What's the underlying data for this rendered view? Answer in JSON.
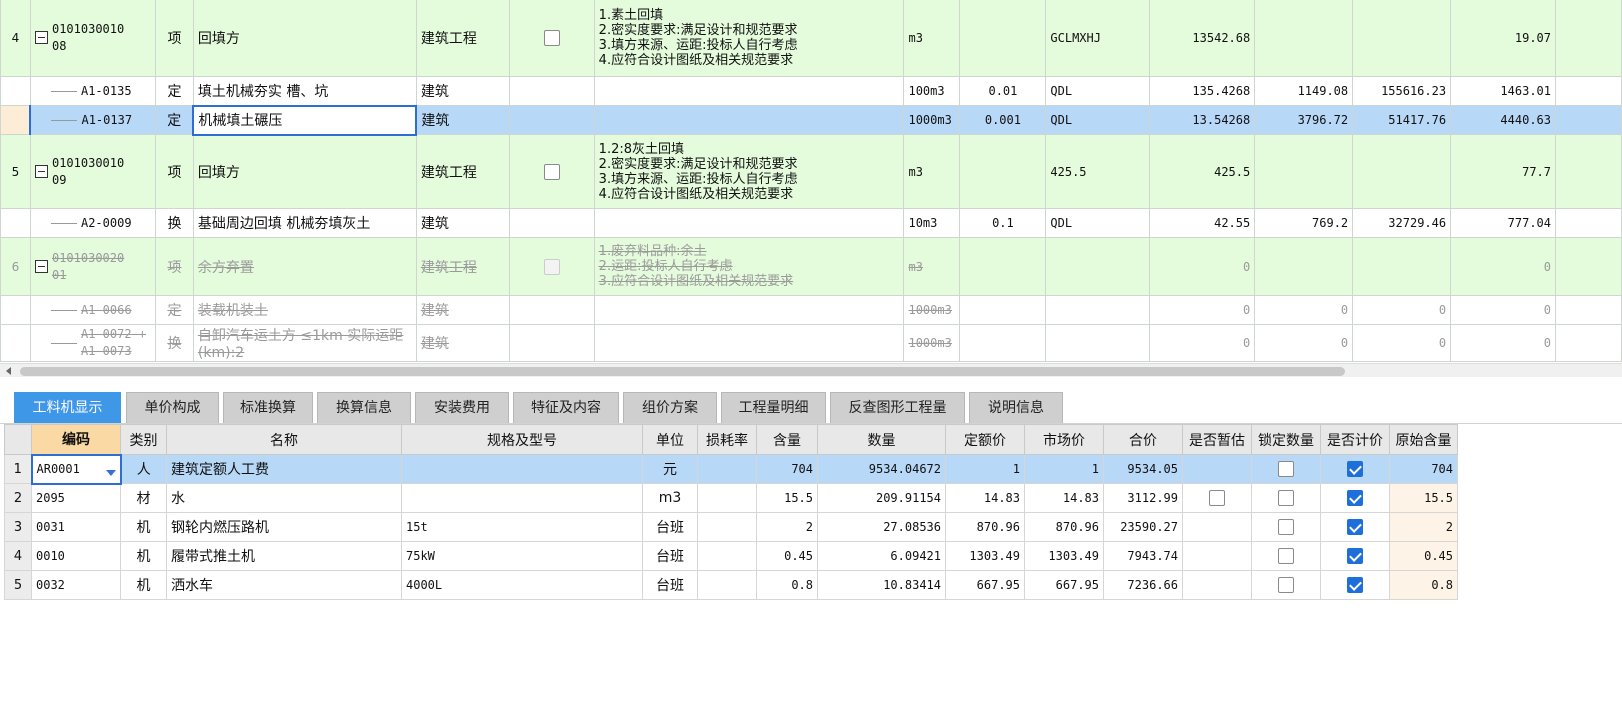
{
  "upper": {
    "rows": [
      {
        "type": "item",
        "no": "4",
        "code": [
          "0101030010",
          "08"
        ],
        "cat": "项",
        "name": "回填方",
        "prof": "建筑工程",
        "desc": [
          "1.素土回填",
          "2.密实度要求:满足设计和规范要求",
          "3.填方来源、运距:投标人自行考虑",
          "4.应符合设计图纸及相关规范要求"
        ],
        "unit": "m3",
        "coef": "",
        "expr": "GCLMXHJ",
        "qty": "13542.68",
        "p1": "",
        "p2": "",
        "p3": "19.07"
      },
      {
        "type": "sub",
        "no": "",
        "code": [
          "A1-0135"
        ],
        "cat": "定",
        "name": "填土机械夯实 槽、坑",
        "prof": "建筑",
        "desc": [],
        "unit": "100m3",
        "coef": "0.01",
        "expr": "QDL",
        "qty": "135.4268",
        "p1": "1149.08",
        "p2": "155616.23",
        "p3": "1463.01"
      },
      {
        "type": "sel",
        "no": "",
        "code": [
          "A1-0137"
        ],
        "cat": "定",
        "name": "机械填土碾压",
        "prof": "建筑",
        "desc": [],
        "unit": "1000m3",
        "coef": "0.001",
        "expr": "QDL",
        "qty": "13.54268",
        "p1": "3796.72",
        "p2": "51417.76",
        "p3": "4440.63"
      },
      {
        "type": "item",
        "no": "5",
        "code": [
          "0101030010",
          "09"
        ],
        "cat": "项",
        "name": "回填方",
        "prof": "建筑工程",
        "desc": [
          "1.2:8灰土回填",
          "2.密实度要求:满足设计和规范要求",
          "3.填方来源、运距:投标人自行考虑",
          "4.应符合设计图纸及相关规范要求"
        ],
        "unit": "m3",
        "coef": "",
        "expr": "425.5",
        "qty": "425.5",
        "p1": "",
        "p2": "",
        "p3": "77.7"
      },
      {
        "type": "sub",
        "no": "",
        "code": [
          "A2-0009"
        ],
        "cat": "换",
        "name": "基础周边回填 机械夯填灰土",
        "prof": "建筑",
        "desc": [],
        "unit": "10m3",
        "coef": "0.1",
        "expr": "QDL",
        "qty": "42.55",
        "p1": "769.2",
        "p2": "32729.46",
        "p3": "777.04"
      },
      {
        "type": "item-dis",
        "no": "6",
        "code": [
          "0101030020",
          "01"
        ],
        "cat": "项",
        "name": "余方弃置",
        "prof": "建筑工程",
        "desc": [
          "1.废弃料品种:余土",
          "2.运距:投标人自行考虑",
          "3.应符合设计图纸及相关规范要求"
        ],
        "unit": "m3",
        "coef": "",
        "expr": "",
        "qty": "0",
        "p1": "",
        "p2": "",
        "p3": "0"
      },
      {
        "type": "sub-dis",
        "no": "",
        "code": [
          "A1-0066"
        ],
        "cat": "定",
        "name": "装载机装土",
        "prof": "建筑",
        "desc": [],
        "unit": "1000m3",
        "coef": "",
        "expr": "",
        "qty": "0",
        "p1": "0",
        "p2": "0",
        "p3": "0"
      },
      {
        "type": "sub-dis",
        "no": "",
        "code": [
          "A1-0072 +",
          "A1-0073"
        ],
        "cat": "换",
        "name": "自卸汽车运土方 ≤1km 实际运距(km):2",
        "prof": "建筑",
        "desc": [],
        "unit": "1000m3",
        "coef": "",
        "expr": "",
        "qty": "0",
        "p1": "0",
        "p2": "0",
        "p3": "0"
      }
    ]
  },
  "tabs": [
    {
      "label": "工料机显示",
      "active": true
    },
    {
      "label": "单价构成",
      "active": false
    },
    {
      "label": "标准换算",
      "active": false
    },
    {
      "label": "换算信息",
      "active": false
    },
    {
      "label": "安装费用",
      "active": false
    },
    {
      "label": "特征及内容",
      "active": false
    },
    {
      "label": "组价方案",
      "active": false
    },
    {
      "label": "工程量明细",
      "active": false
    },
    {
      "label": "反查图形工程量",
      "active": false
    },
    {
      "label": "说明信息",
      "active": false
    }
  ],
  "lower": {
    "headers": [
      "",
      "编码",
      "类别",
      "名称",
      "规格及型号",
      "单位",
      "损耗率",
      "含量",
      "数量",
      "定额价",
      "市场价",
      "合价",
      "是否暂估",
      "锁定数量",
      "是否计价",
      "原始含量"
    ],
    "rows": [
      {
        "no": "1",
        "code": "AR0001",
        "cat": "人",
        "name": "建筑定额人工费",
        "spec": "",
        "unit": "元",
        "loss": "",
        "content": "704",
        "qty": "9534.04672",
        "quota": "1",
        "market": "1",
        "total": "9534.05",
        "est": null,
        "lock": false,
        "priced": true,
        "orig": "704"
      },
      {
        "no": "2",
        "code": "2095",
        "cat": "材",
        "name": "水",
        "spec": "",
        "unit": "m3",
        "loss": "",
        "content": "15.5",
        "qty": "209.91154",
        "quota": "14.83",
        "market": "14.83",
        "total": "3112.99",
        "est": false,
        "lock": false,
        "priced": true,
        "orig": "15.5"
      },
      {
        "no": "3",
        "code": "0031",
        "cat": "机",
        "name": "钢轮内燃压路机",
        "spec": "15t",
        "unit": "台班",
        "loss": "",
        "content": "2",
        "qty": "27.08536",
        "quota": "870.96",
        "market": "870.96",
        "total": "23590.27",
        "est": null,
        "lock": false,
        "priced": true,
        "orig": "2"
      },
      {
        "no": "4",
        "code": "0010",
        "cat": "机",
        "name": "履带式推土机",
        "spec": "75kW",
        "unit": "台班",
        "loss": "",
        "content": "0.45",
        "qty": "6.09421",
        "quota": "1303.49",
        "market": "1303.49",
        "total": "7943.74",
        "est": null,
        "lock": false,
        "priced": true,
        "orig": "0.45"
      },
      {
        "no": "5",
        "code": "0032",
        "cat": "机",
        "name": "洒水车",
        "spec": "4000L",
        "unit": "台班",
        "loss": "",
        "content": "0.8",
        "qty": "10.83414",
        "quota": "667.95",
        "market": "667.95",
        "total": "7236.66",
        "est": null,
        "lock": false,
        "priced": true,
        "orig": "0.8"
      }
    ]
  }
}
